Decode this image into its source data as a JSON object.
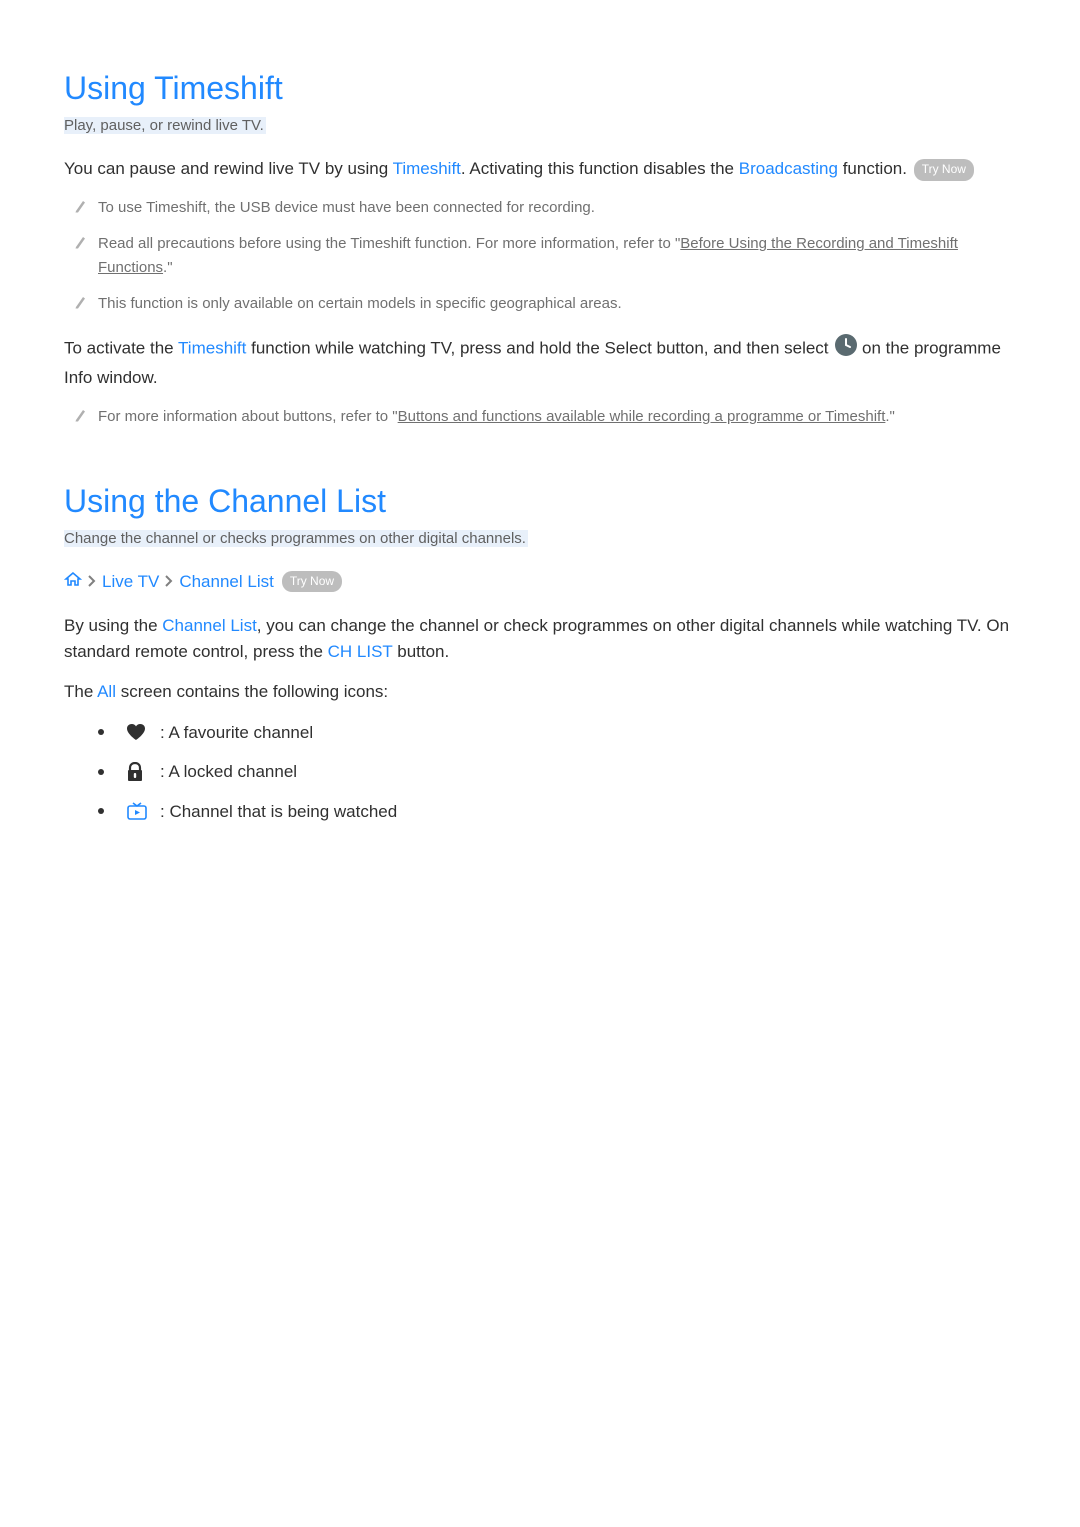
{
  "section1": {
    "title": "Using Timeshift",
    "subtitle": "Play, pause, or rewind live TV.",
    "para1_a": "You can pause and rewind live TV by using ",
    "para1_term1": "Timeshift",
    "para1_b": ". Activating this function disables the ",
    "para1_term2": "Broadcasting",
    "para1_c": " function. ",
    "try_now": "Try Now",
    "notes": {
      "n1": "To use Timeshift, the USB device must have been connected for recording.",
      "n2_a": "Read all precautions before using the Timeshift function. For more information, refer to \"",
      "n2_link": "Before Using the Recording and Timeshift Functions",
      "n2_b": ".\"",
      "n3": "This function is only available on certain models in specific geographical areas."
    },
    "para2_a": "To activate the ",
    "para2_term": "Timeshift",
    "para2_b": " function while watching TV, press and hold the Select button, and then select ",
    "para2_c": " on the programme Info window.",
    "notes2": {
      "n1_a": "For more information about buttons, refer to \"",
      "n1_link": "Buttons and functions available while recording a programme or Timeshift",
      "n1_b": ".\""
    }
  },
  "section2": {
    "title": "Using the Channel List",
    "subtitle": "Change the channel or checks programmes on other digital channels.",
    "breadcrumb": {
      "b1": "Live TV",
      "b2": "Channel List",
      "try_now": "Try Now"
    },
    "para1_a": "By using the ",
    "para1_term": "Channel List",
    "para1_b": ", you can change the channel or check programmes on other digital channels while watching TV. On standard remote control, press the ",
    "para1_term2": "CH LIST",
    "para1_c": " button.",
    "para2_a": "The ",
    "para2_term": "All",
    "para2_b": " screen contains the following icons:",
    "icons": {
      "fav": " : A favourite channel",
      "lock": " : A locked channel",
      "watch": " : Channel that is being watched"
    }
  }
}
